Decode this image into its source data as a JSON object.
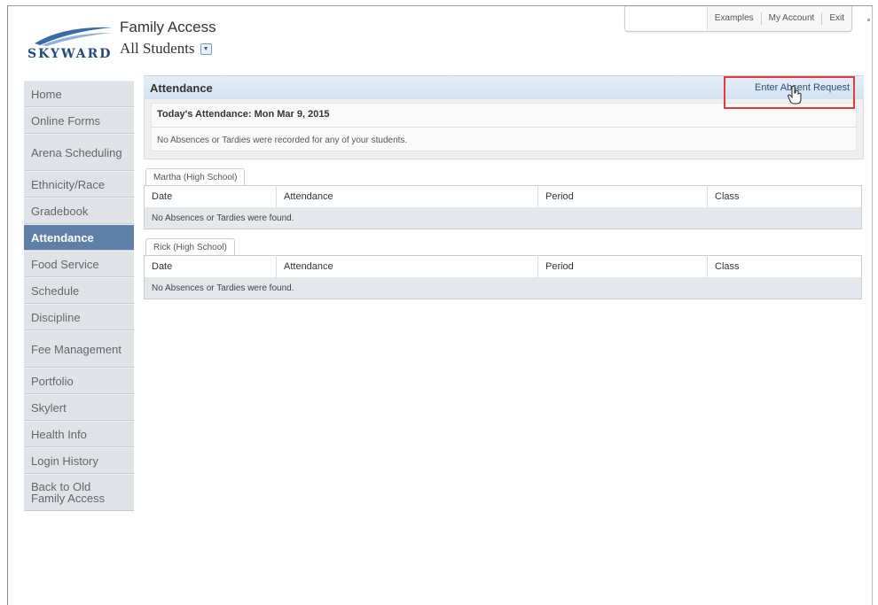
{
  "header": {
    "logo_text": "SKYWARD",
    "app_title": "Family Access",
    "student_selector": "All Students"
  },
  "top_links": [
    "Examples",
    "My Account",
    "Exit"
  ],
  "sidebar": {
    "items": [
      {
        "label": "Home",
        "active": false
      },
      {
        "label": "Online Forms",
        "active": false
      },
      {
        "label": "Arena Scheduling",
        "active": false
      },
      {
        "label": "Ethnicity/Race",
        "active": false
      },
      {
        "label": "Gradebook",
        "active": false
      },
      {
        "label": "Attendance",
        "active": true
      },
      {
        "label": "Food Service",
        "active": false
      },
      {
        "label": "Schedule",
        "active": false
      },
      {
        "label": "Discipline",
        "active": false
      },
      {
        "label": "Fee Management",
        "active": false
      },
      {
        "label": "Portfolio",
        "active": false
      },
      {
        "label": "Skylert",
        "active": false
      },
      {
        "label": "Health Info",
        "active": false
      },
      {
        "label": "Login History",
        "active": false
      },
      {
        "label": "Back to Old Family Access",
        "active": false
      }
    ]
  },
  "main": {
    "title": "Attendance",
    "enter_absent_request": "Enter Absent Request",
    "today": {
      "title": "Today's Attendance: Mon Mar 9, 2015",
      "message": "No Absences or Tardies were recorded for any of your students."
    },
    "columns": [
      "Date",
      "Attendance",
      "Period",
      "Class"
    ],
    "students": [
      {
        "name": "Martha (High School)",
        "empty_message": "No Absences or Tardies were found."
      },
      {
        "name": "Rick (High School)",
        "empty_message": "No Absences or Tardies were found."
      }
    ]
  },
  "colors": {
    "accent": "#5e7fa8",
    "highlight_box": "#e23b3b",
    "link": "#2d4e7a"
  }
}
